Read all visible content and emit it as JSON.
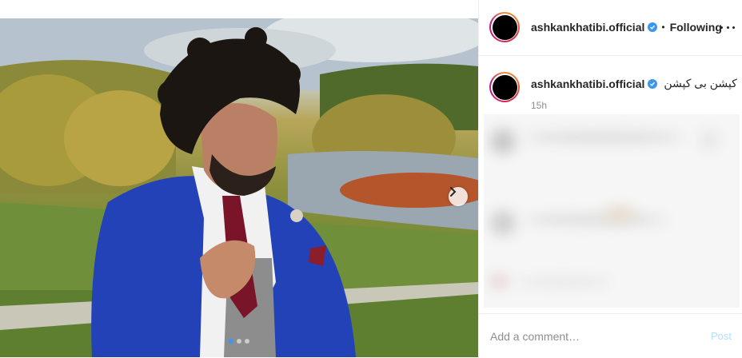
{
  "post": {
    "image_alt": "",
    "carousel": {
      "total_slides": 3,
      "active_slide": 1
    }
  },
  "header": {
    "username": "ashkankhatibi.official",
    "separator": "•",
    "follow_label": "Following",
    "more_icon": "more-horizontal-icon"
  },
  "caption": {
    "username": "ashkankhatibi.official",
    "text": "کپشن بی کپشن",
    "timestamp": "15h"
  },
  "comment": {
    "placeholder": "Add a comment…",
    "post_label": "Post"
  },
  "colors": {
    "verified": "#3897f0",
    "post_disabled": "#b2dffc",
    "secondary_text": "#8e8e8e",
    "border": "#efefef"
  }
}
